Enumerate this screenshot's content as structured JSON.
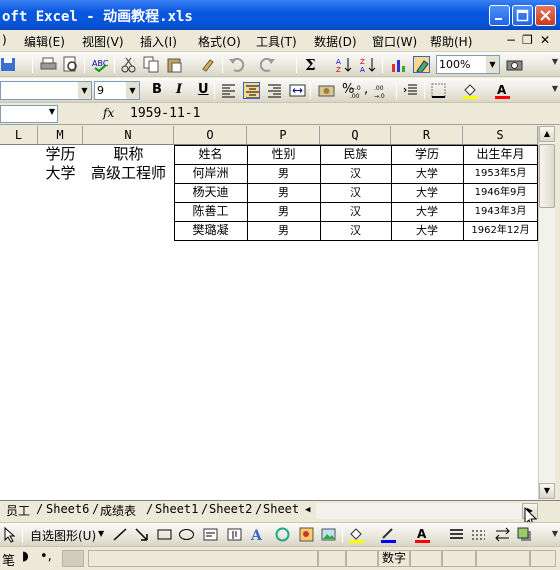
{
  "window": {
    "title": "oft Excel - 动画教程.xls",
    "controls": [
      "minimize",
      "maximize",
      "close"
    ]
  },
  "menu": {
    "items": [
      "编辑(E)",
      "视图(V)",
      "插入(I)",
      "格式(O)",
      "工具(T)",
      "数据(D)",
      "窗口(W)",
      "帮助(H)"
    ],
    "left_fragment": ")",
    "mdi_restore": "▫ ×"
  },
  "standard_toolbar": {
    "zoom": "100%",
    "icons": [
      "print-icon",
      "print-preview-icon",
      "spelling-icon",
      "cut-icon",
      "copy-icon",
      "paste-icon",
      "format-painter-icon",
      "undo-icon",
      "redo-icon",
      "autosum-icon",
      "sort-ascending-icon",
      "sort-descending-icon",
      "chart-wizard-icon",
      "drawing-icon",
      "zoom-icon",
      "camera-icon"
    ]
  },
  "formatting_toolbar": {
    "font_size": "9",
    "bold": "B",
    "italic": "I",
    "underline": "U",
    "percent": "%",
    "comma": ",",
    "inc_decimal": "+.0 .00",
    "dec_decimal": ".00 +.0"
  },
  "formula_bar": {
    "name_box": "",
    "fx": "fx",
    "value": "1959-11-1"
  },
  "grid": {
    "columns": [
      "L",
      "M",
      "N",
      "O",
      "P",
      "Q",
      "R",
      "S"
    ],
    "left_cells": {
      "row1": [
        "学历",
        "职称"
      ],
      "row2": [
        "大学",
        "高级工程师"
      ]
    },
    "table": {
      "headers": [
        "姓名",
        "性别",
        "民族",
        "学历",
        "出生年月"
      ],
      "rows": [
        [
          "何岸洲",
          "男",
          "汉",
          "大学",
          "1953年5月"
        ],
        [
          "杨天迪",
          "男",
          "汉",
          "大学",
          "1946年9月"
        ],
        [
          "陈善工",
          "男",
          "汉",
          "大学",
          "1943年3月"
        ],
        [
          "樊璐凝",
          "男",
          "汉",
          "大学",
          "1962年12月"
        ]
      ]
    }
  },
  "sheet_tabs": [
    "员工",
    "Sheet6",
    "成绩表",
    "Sheet1",
    "Sheet2",
    "Sheet"
  ],
  "draw_toolbar": {
    "autoshapes": "自选图形(U)"
  },
  "status_bar": {
    "ime_label": "笔",
    "mode": "数字"
  }
}
